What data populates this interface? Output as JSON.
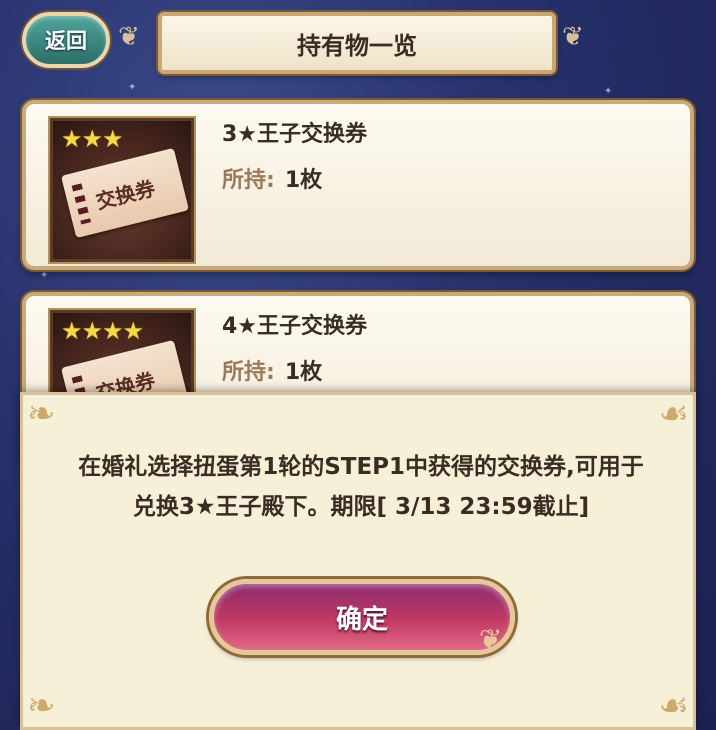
{
  "header": {
    "back_label": "返回",
    "title": "持有物一览"
  },
  "items": [
    {
      "name": "3★王子交换券",
      "stars": "★★★",
      "ticket_label": "交换券",
      "qty_label": "所持:",
      "qty_value": "1枚"
    },
    {
      "name": "4★王子交换券",
      "stars": "★★★★",
      "ticket_label": "交换券",
      "qty_label": "所持:",
      "qty_value": "1枚"
    }
  ],
  "dialog": {
    "line1": "在婚礼选择扭蛋第1轮的STEP1中获得的交换券,可用于",
    "line2": "兑换3★王子殿下。期限[ 3/13 23:59截止]",
    "confirm_label": "确定"
  },
  "colors": {
    "background": "#26306a",
    "panel": "#f7f0d9",
    "accent_button": "#c23a62",
    "back_button": "#3d8a80"
  }
}
